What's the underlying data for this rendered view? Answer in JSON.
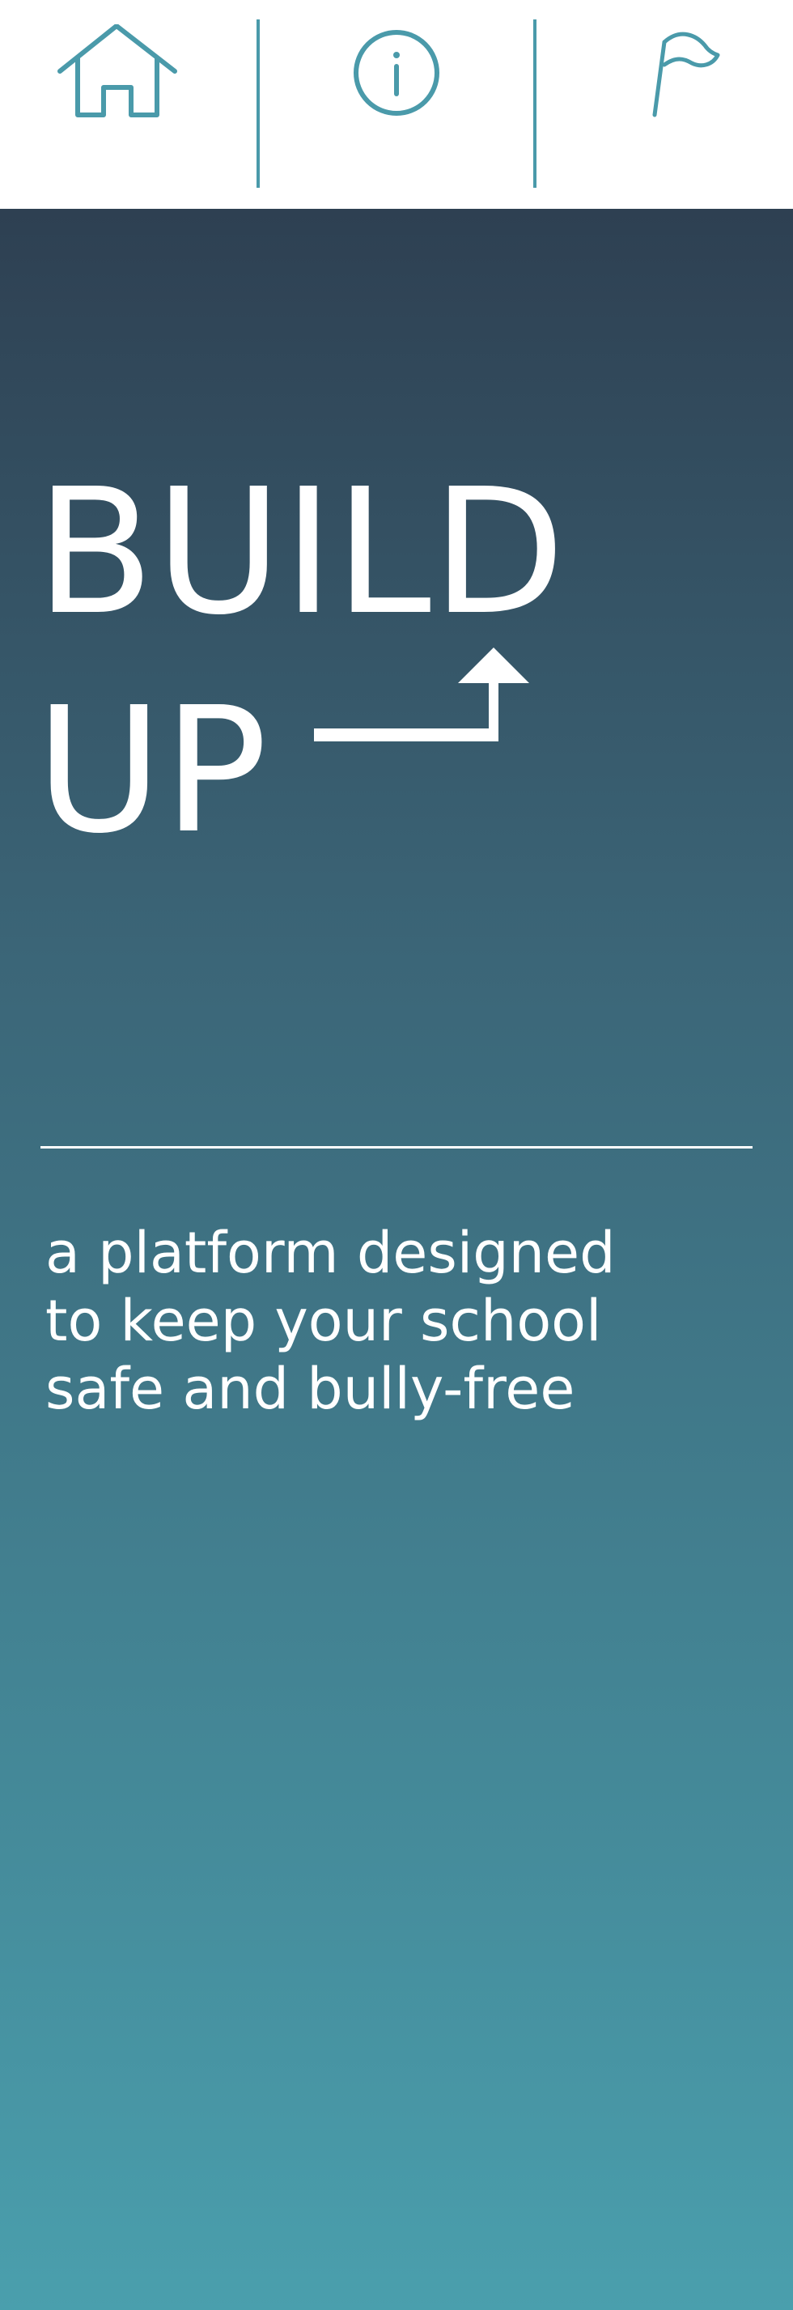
{
  "nav": {
    "items": [
      {
        "icon": "home-icon"
      },
      {
        "icon": "info-icon"
      },
      {
        "icon": "flag-icon"
      }
    ],
    "accent_color": "#4a9aaa"
  },
  "hero": {
    "title_line_1": "BUILD",
    "title_line_2": "UP",
    "arrow_icon": "arrow-up-right-turn-icon",
    "tagline": "a platform designed to keep your school safe and bully-free",
    "gradient_top": "#2e4052",
    "gradient_bottom": "#4a9fad",
    "text_color": "#ffffff"
  }
}
